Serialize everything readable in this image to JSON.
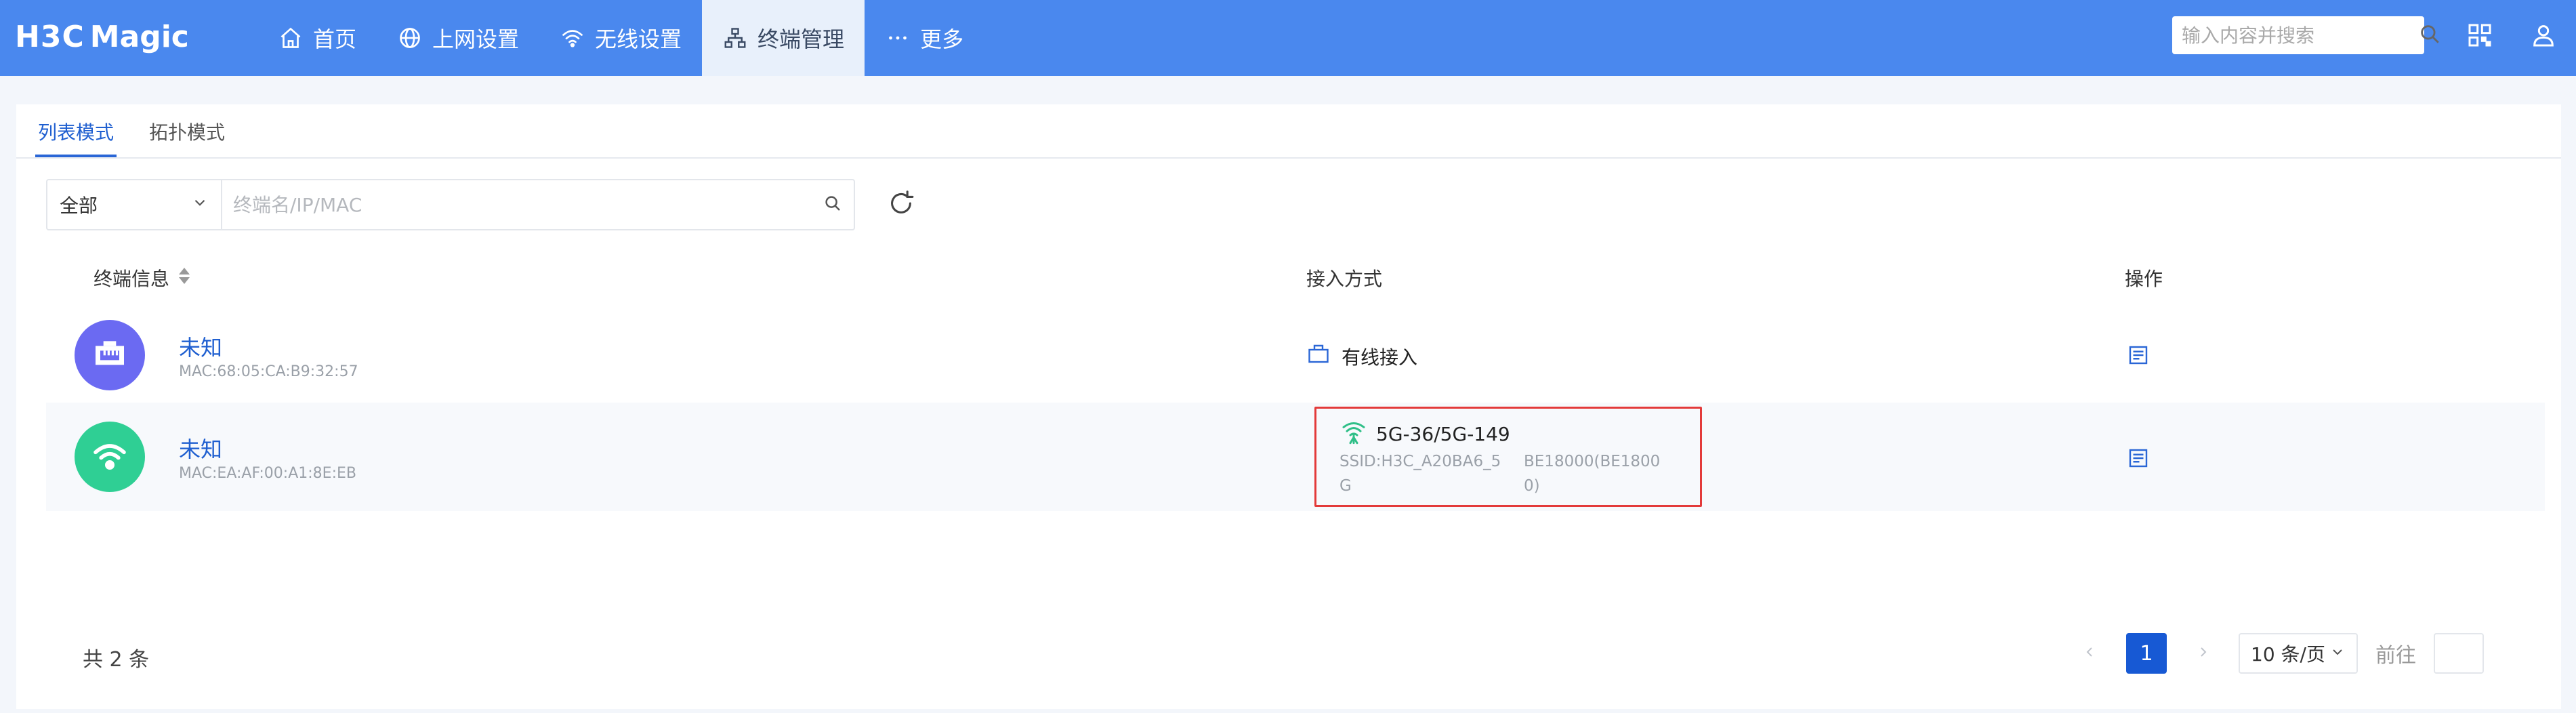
{
  "brand": {
    "logo_h3c": "H3C",
    "logo_magic": "Magic"
  },
  "nav": [
    {
      "label": "首页",
      "icon": "home-icon"
    },
    {
      "label": "上网设置",
      "icon": "globe-icon"
    },
    {
      "label": "无线设置",
      "icon": "wifi-icon"
    },
    {
      "label": "终端管理",
      "icon": "topology-icon",
      "active": true
    },
    {
      "label": "更多",
      "icon": "more-icon"
    }
  ],
  "header": {
    "search_placeholder": "输入内容并搜索"
  },
  "tabs": [
    {
      "label": "列表模式",
      "active": true
    },
    {
      "label": "拓扑模式",
      "active": false
    }
  ],
  "filter": {
    "selected": "全部",
    "placeholder": "终端名/IP/MAC"
  },
  "table": {
    "columns": [
      "终端信息",
      "接入方式",
      "操作"
    ],
    "rows": [
      {
        "name": "未知",
        "mac": "MAC:68:05:CA:B9:32:57",
        "avatar_icon": "ethernet-icon",
        "avatar_color": "#6b6af2",
        "access": "有线接入"
      },
      {
        "name": "未知",
        "mac": "MAC:EA:AF:00:A1:8E:EB",
        "avatar_icon": "wifi-icon",
        "avatar_color": "#2fcf94",
        "access_band": "5G-36/5G-149",
        "access_ssid": "SSID:H3C_A20BA6_5G",
        "access_model": "BE18000(BE18000)"
      }
    ]
  },
  "pagination": {
    "total": "共 2 条",
    "current": "1",
    "page_size": "10 条/页",
    "goto_label": "前往"
  },
  "colors": {
    "topbar": "#4a88ee",
    "accent": "#1759d4",
    "highlight_border": "#e33a3a"
  }
}
